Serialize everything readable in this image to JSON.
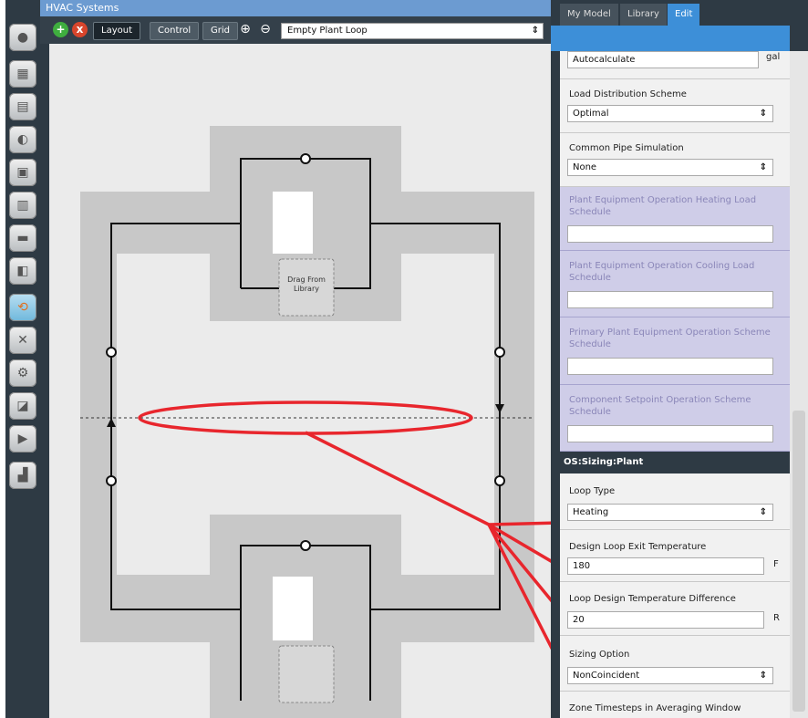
{
  "window_title": "HVAC Systems",
  "toolbar": {
    "add_label": "+",
    "remove_label": "x",
    "layout_label": "Layout",
    "control_label": "Control",
    "grid_label": "Grid",
    "zoom_in": "⊕",
    "zoom_out": "⊖",
    "loop_select": "Empty Plant Loop",
    "select_arrow": "⇕"
  },
  "diagram": {
    "drag_label": "Drag From Library"
  },
  "tabs": [
    "My Model",
    "Library",
    "Edit"
  ],
  "form": {
    "top_value": "Autocalculate",
    "top_unit": "gal",
    "load_distribution": {
      "label": "Load Distribution Scheme",
      "value": "Optimal"
    },
    "common_pipe": {
      "label": "Common Pipe Simulation",
      "value": "None"
    },
    "heating_sched": {
      "label": "Plant Equipment Operation Heating Load Schedule",
      "value": ""
    },
    "cooling_sched": {
      "label": "Plant Equipment Operation Cooling Load Schedule",
      "value": ""
    },
    "primary_sched": {
      "label": "Primary Plant Equipment Operation Scheme Schedule",
      "value": ""
    },
    "component_sched": {
      "label": "Component Setpoint Operation Scheme Schedule",
      "value": ""
    },
    "sizing_header": "OS:Sizing:Plant",
    "loop_type": {
      "label": "Loop Type",
      "value": "Heating"
    },
    "exit_temp": {
      "label": "Design Loop Exit Temperature",
      "value": "180",
      "unit": "F"
    },
    "temp_diff": {
      "label": "Loop Design Temperature Difference",
      "value": "20",
      "unit": "R"
    },
    "sizing_option": {
      "label": "Sizing Option",
      "value": "NonCoincident"
    },
    "zone_timesteps": {
      "label": "Zone Timesteps in Averaging Window"
    }
  },
  "colors": {
    "annotation": "#e8262d",
    "accent": "#3d8fd8",
    "dark": "#2e3a44",
    "schedule_bg": "#cfcde8"
  },
  "icons": [
    "circle-icon",
    "calendar-icon",
    "building-icon",
    "globe-icon",
    "space-icon",
    "thermal-zone-icon",
    "load-icon",
    "construction-icon",
    "hvac-loop-icon",
    "tools-icon",
    "gear-icon",
    "report-icon",
    "play-icon",
    "chart-icon"
  ]
}
